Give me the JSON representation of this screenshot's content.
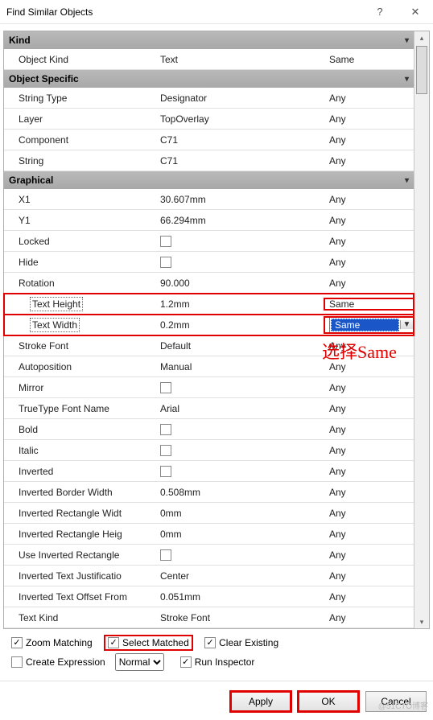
{
  "window": {
    "title": "Find Similar Objects",
    "help": "?",
    "close": "✕"
  },
  "sections": {
    "kind": "Kind",
    "object_specific": "Object Specific",
    "graphical": "Graphical"
  },
  "rows": {
    "object_kind": {
      "name": "Object Kind",
      "value": "Text",
      "match": "Same"
    },
    "string_type": {
      "name": "String Type",
      "value": "Designator",
      "match": "Any"
    },
    "layer": {
      "name": "Layer",
      "value": "TopOverlay",
      "match": "Any"
    },
    "component": {
      "name": "Component",
      "value": "C71",
      "match": "Any"
    },
    "string": {
      "name": "String",
      "value": "C71",
      "match": "Any"
    },
    "x1": {
      "name": "X1",
      "value": "30.607mm",
      "match": "Any"
    },
    "y1": {
      "name": "Y1",
      "value": "66.294mm",
      "match": "Any"
    },
    "locked": {
      "name": "Locked",
      "check": false,
      "match": "Any"
    },
    "hide": {
      "name": "Hide",
      "check": false,
      "match": "Any"
    },
    "rotation": {
      "name": "Rotation",
      "value": "90.000",
      "match": "Any"
    },
    "text_height": {
      "name": "Text Height",
      "value": "1.2mm",
      "match": "Same"
    },
    "text_width": {
      "name": "Text Width",
      "value": "0.2mm",
      "match": "Same"
    },
    "stroke_font": {
      "name": "Stroke Font",
      "value": "Default",
      "match": "Any"
    },
    "autoposition": {
      "name": "Autoposition",
      "value": "Manual",
      "match": "Any"
    },
    "mirror": {
      "name": "Mirror",
      "check": false,
      "match": "Any"
    },
    "tt_font": {
      "name": "TrueType Font Name",
      "value": "Arial",
      "match": "Any"
    },
    "bold": {
      "name": "Bold",
      "check": false,
      "match": "Any"
    },
    "italic": {
      "name": "Italic",
      "check": false,
      "match": "Any"
    },
    "inverted": {
      "name": "Inverted",
      "check": false,
      "match": "Any"
    },
    "inv_border": {
      "name": "Inverted Border Width",
      "value": "0.508mm",
      "match": "Any"
    },
    "inv_rect_w": {
      "name": "Inverted Rectangle Widt",
      "value": "0mm",
      "match": "Any"
    },
    "inv_rect_h": {
      "name": "Inverted Rectangle Heig",
      "value": "0mm",
      "match": "Any"
    },
    "use_inv_rect": {
      "name": "Use Inverted Rectangle",
      "check": false,
      "match": "Any"
    },
    "inv_just": {
      "name": "Inverted Text Justificatio",
      "value": "Center",
      "match": "Any"
    },
    "inv_off": {
      "name": "Inverted Text Offset From",
      "value": "0.051mm",
      "match": "Any"
    },
    "text_kind": {
      "name": "Text Kind",
      "value": "Stroke Font",
      "match": "Any"
    }
  },
  "footer": {
    "zoom_matching": "Zoom Matching",
    "select_matched": "Select Matched",
    "clear_existing": "Clear Existing",
    "create_expression": "Create Expression",
    "mask_mode": "Normal",
    "run_inspector": "Run Inspector"
  },
  "buttons": {
    "apply": "Apply",
    "ok": "OK",
    "cancel": "Cancel"
  },
  "annotation": "选择Same",
  "watermark": "@51CTO博客"
}
